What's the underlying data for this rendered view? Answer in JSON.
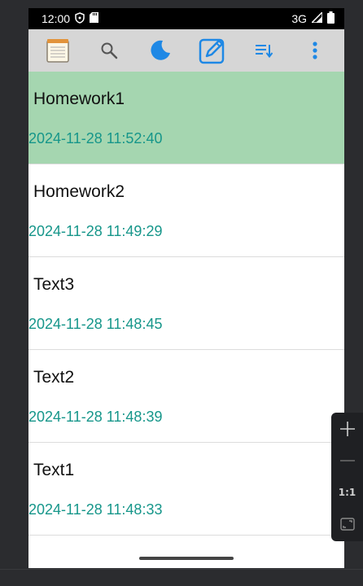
{
  "status_bar": {
    "time": "12:00",
    "network": "3G"
  },
  "toolbar": {
    "icons": [
      "notepad-icon",
      "search-icon",
      "night-mode-icon",
      "edit-note-icon",
      "sort-icon",
      "overflow-menu-icon"
    ],
    "accent": "#1e88e5"
  },
  "notes": [
    {
      "title": "Homework1",
      "date": "2024-11-28 11:52:40",
      "selected": true
    },
    {
      "title": "Homework2",
      "date": "2024-11-28 11:49:29",
      "selected": false
    },
    {
      "title": "Text3",
      "date": "2024-11-28 11:48:45",
      "selected": false
    },
    {
      "title": "Text2",
      "date": "2024-11-28 11:48:39",
      "selected": false
    },
    {
      "title": "Text1",
      "date": "2024-11-28 11:48:33",
      "selected": false
    }
  ],
  "colors": {
    "selected_bg": "#a5d6b0",
    "date_text": "#16968a",
    "toolbar_bg": "#d6d6d6"
  },
  "zoom_controls": {
    "reset_label": "1:1"
  }
}
